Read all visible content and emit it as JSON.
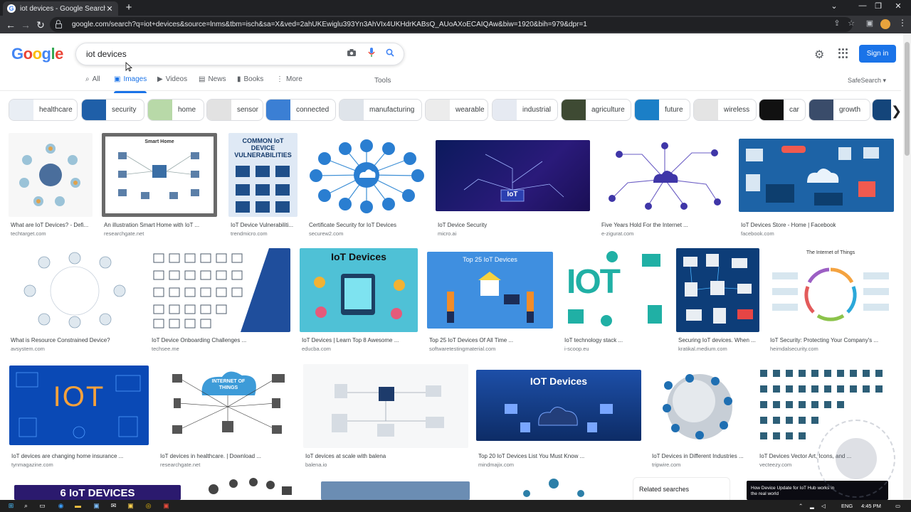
{
  "browser": {
    "tab_title": "iot devices - Google Search",
    "tab_favicon": "G",
    "url": "google.com/search?q=iot+devices&source=lnms&tbm=isch&sa=X&ved=2ahUKEwiglu393Yn3AhVIx4UKHdrKABsQ_AUoAXoECAIQAw&biw=1920&bih=979&dpr=1"
  },
  "search": {
    "query": "iot devices",
    "signin_label": "Sign in"
  },
  "tabs": [
    {
      "label": "All",
      "icon": "search-icon"
    },
    {
      "label": "Images",
      "icon": "image-icon"
    },
    {
      "label": "Videos",
      "icon": "video-icon"
    },
    {
      "label": "News",
      "icon": "news-icon"
    },
    {
      "label": "Books",
      "icon": "book-icon"
    },
    {
      "label": "More",
      "icon": "more-icon"
    }
  ],
  "tools_label": "Tools",
  "safesearch_label": "SafeSearch",
  "chips": [
    "healthcare",
    "security",
    "home",
    "sensor",
    "connected",
    "manufacturing",
    "wearable",
    "industrial",
    "agriculture",
    "future",
    "wireless",
    "car",
    "growth"
  ],
  "results_row1": [
    {
      "caption": "What are IoT Devices? - Defi...",
      "source": "techtarget.com"
    },
    {
      "caption": "An illustration Smart Home with IoT ...",
      "source": "researchgate.net"
    },
    {
      "caption": "IoT Device Vulnerabiliti...",
      "source": "trendmicro.com"
    },
    {
      "caption": "Certificate Security for IoT Devices",
      "source": "securew2.com"
    },
    {
      "caption": "IoT Device Security",
      "source": "micro.ai"
    },
    {
      "caption": "Five Years Hold For the Internet ...",
      "source": "e-zigurat.com"
    },
    {
      "caption": "IoT Devices Store - Home | Facebook",
      "source": "facebook.com"
    }
  ],
  "results_row2": [
    {
      "caption": "What is Resource Constrained Device?",
      "source": "avsystem.com"
    },
    {
      "caption": "IoT Device Onboarding Challenges ...",
      "source": "techsee.me"
    },
    {
      "caption": "IoT Devices | Learn Top 8 Awesome ...",
      "source": "educba.com"
    },
    {
      "caption": "Top 25 IoT Devices Of All Time ...",
      "source": "softwaretestingmaterial.com"
    },
    {
      "caption": "IoT technology stack ...",
      "source": "i-scoop.eu"
    },
    {
      "caption": "Securing IoT devices. When ...",
      "source": "kratikal.medium.com"
    },
    {
      "caption": "IoT Security: Protecting Your Company's ...",
      "source": "heimdalsecurity.com"
    }
  ],
  "results_row3": [
    {
      "caption": "IoT devices are changing home insurance ...",
      "source": "tynmagazine.com"
    },
    {
      "caption": "IoT devices in healthcare. | Download ...",
      "source": "researchgate.net"
    },
    {
      "caption": "IoT devices at scale with balena",
      "source": "balena.io"
    },
    {
      "caption": "Top 20 IoT Devices List You Must Know ...",
      "source": "mindmajix.com"
    },
    {
      "caption": "IoT Devices in Different Industries ...",
      "source": "tripwire.com"
    },
    {
      "caption": "IoT Devices Vector Art, Icons, and ...",
      "source": "vecteezy.com"
    }
  ],
  "thumb_text": {
    "smart_home": "Smart Home",
    "common_iot": "COMMON IoT DEVICE VULNERABILITIES",
    "iot_label": "IoT",
    "iot_devices_educba": "IoT Devices",
    "top25": "Top 25 IoT Devices",
    "iot_internet": "IOT",
    "internet_of_things": "The Internet of Things",
    "iot_big": "IOT",
    "internet_of_things_cloud": "INTERNET OF THINGS",
    "iot_devices_mindmajix": "IOT Devices",
    "bottom_iot": "6 IoT DEVICES",
    "bottom_right": "How Device Update for IoT Hub works in the real world"
  },
  "related_label": "Related searches",
  "taskbar": {
    "lang": "ENG",
    "time": "4:45 PM"
  },
  "colors": {
    "accent": "#1a73e8",
    "chrome_dark": "#202124",
    "chrome_mid": "#35363a"
  }
}
